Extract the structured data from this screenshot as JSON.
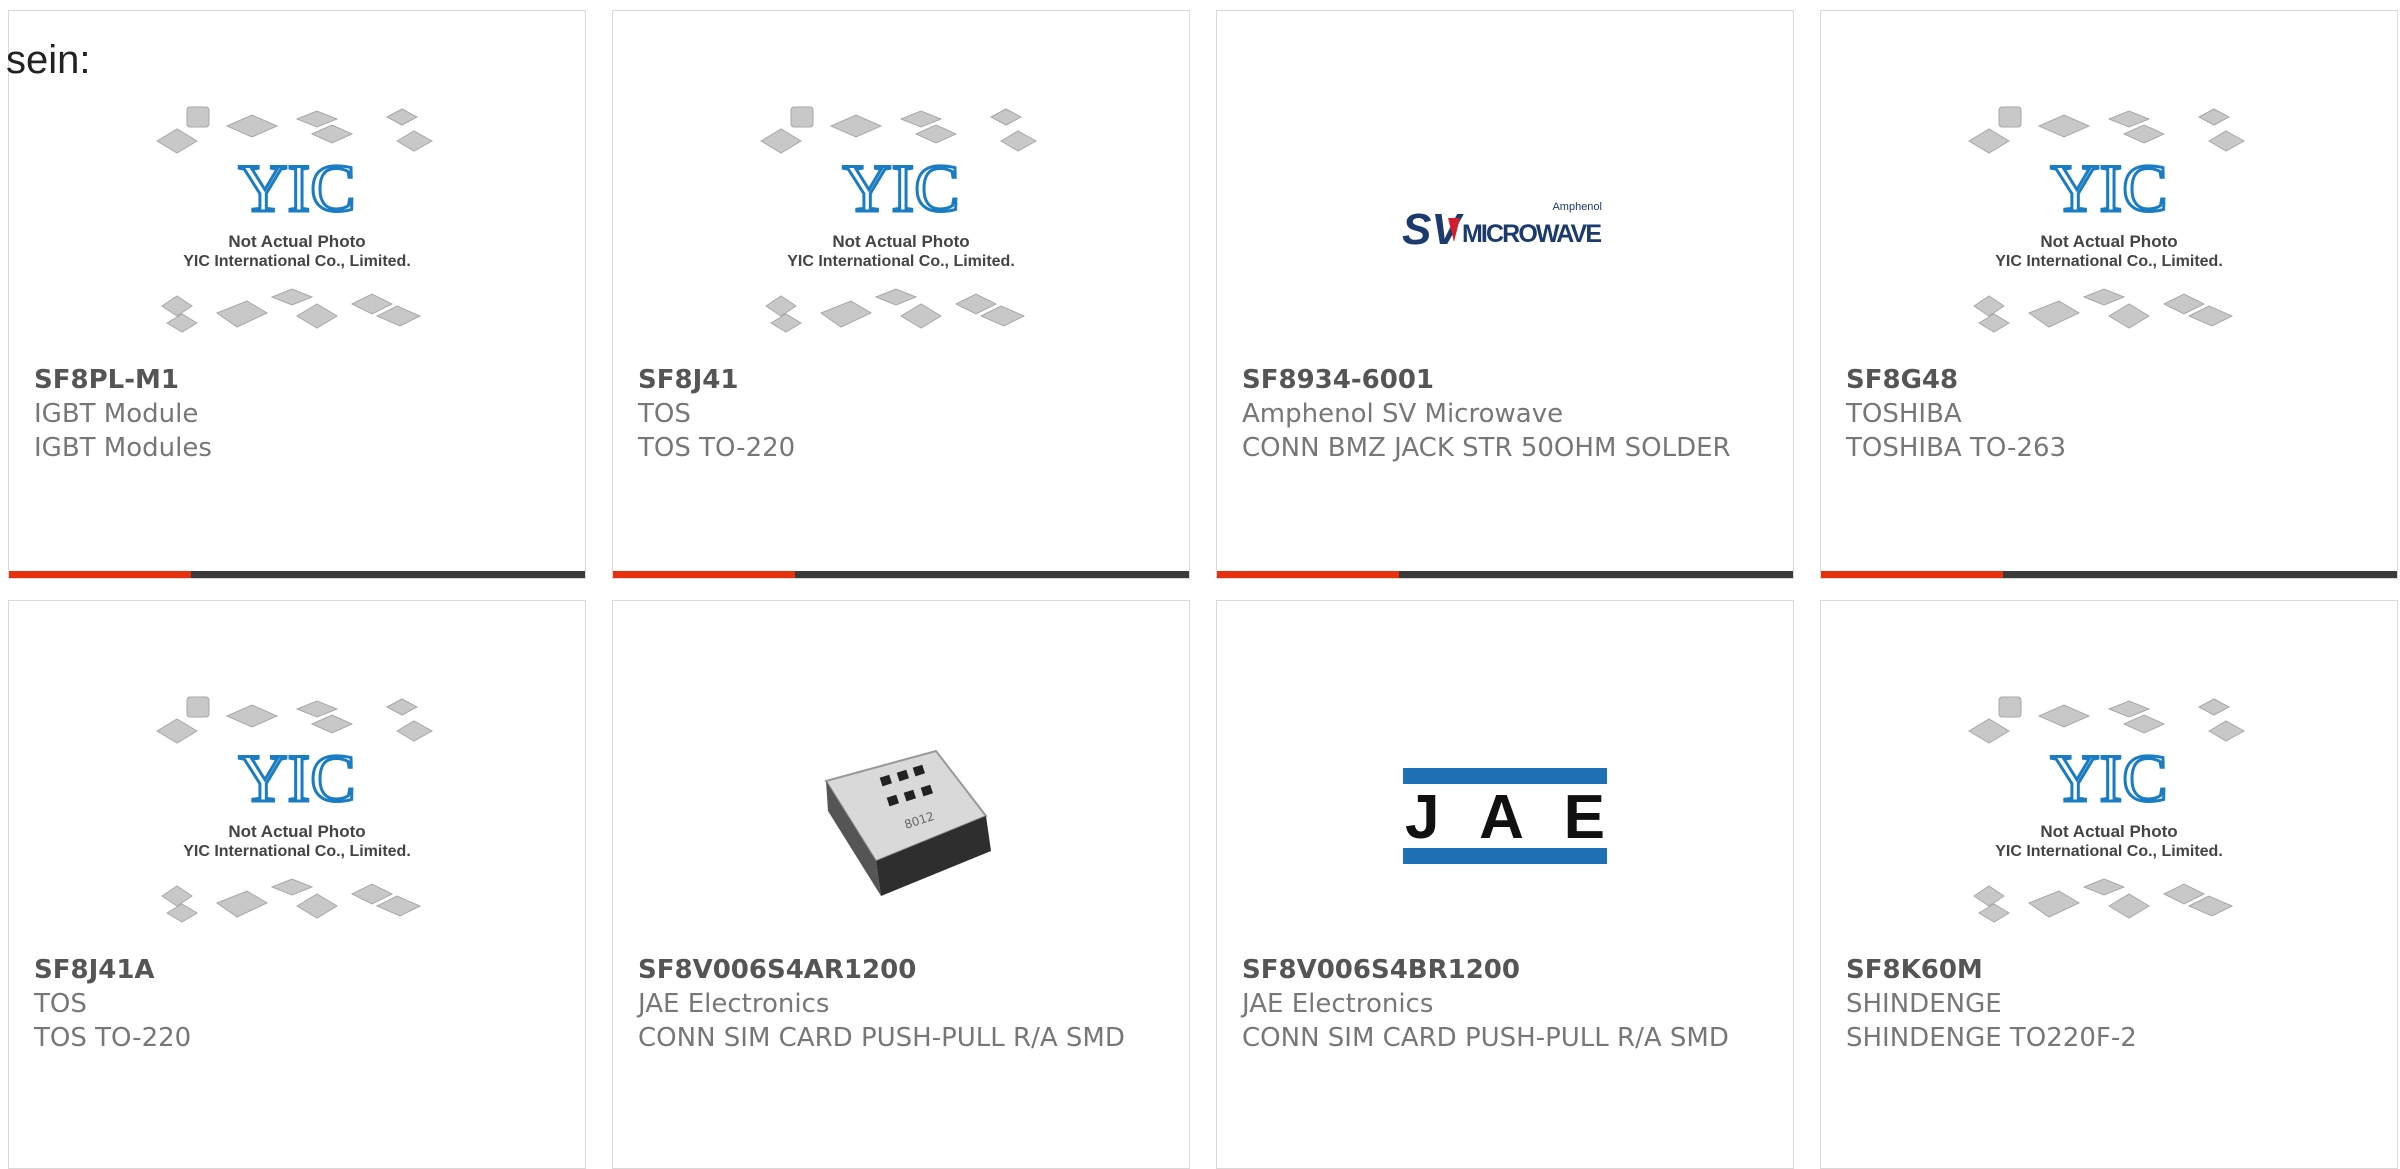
{
  "lead_text": "sein:",
  "placeholder": {
    "line1": "Not Actual Photo",
    "line2": "YIC International Co., Limited."
  },
  "products": [
    {
      "part": "SF8PL-M1",
      "maker": "IGBT Module",
      "desc": "IGBT Modules",
      "image": "yic-placeholder"
    },
    {
      "part": "SF8J41",
      "maker": "TOS",
      "desc": "TOS TO-220",
      "image": "yic-placeholder"
    },
    {
      "part": "SF8934-6001",
      "maker": "Amphenol SV Microwave",
      "desc": "CONN BMZ JACK STR 50OHM SOLDER",
      "image": "sv-microwave-logo"
    },
    {
      "part": "SF8G48",
      "maker": "TOSHIBA",
      "desc": "TOSHIBA TO-263",
      "image": "yic-placeholder"
    },
    {
      "part": "SF8J41A",
      "maker": "TOS",
      "desc": "TOS TO-220",
      "image": "yic-placeholder"
    },
    {
      "part": "SF8V006S4AR1200",
      "maker": "JAE Electronics",
      "desc": "CONN SIM CARD PUSH-PULL R/A SMD",
      "image": "sim-connector-photo"
    },
    {
      "part": "SF8V006S4BR1200",
      "maker": "JAE Electronics",
      "desc": "CONN SIM CARD PUSH-PULL R/A SMD",
      "image": "jae-logo"
    },
    {
      "part": "SF8K60M",
      "maker": "SHINDENGE",
      "desc": "SHINDENGE TO220F-2",
      "image": "yic-placeholder"
    }
  ],
  "logos": {
    "sv_brand": "Amphenol",
    "sv_main": "SV",
    "sv_sub": "MICROWAVE",
    "jae": "JAE",
    "yic": "YIC",
    "sim_marking": "8012"
  },
  "colors": {
    "accent": "#e6320e",
    "bar": "#3a3a3a",
    "yic_blue": "#1a7cc2",
    "sv_navy": "#1b3a6e",
    "sv_red": "#d02030",
    "jae_blue": "#1e6fb3"
  }
}
